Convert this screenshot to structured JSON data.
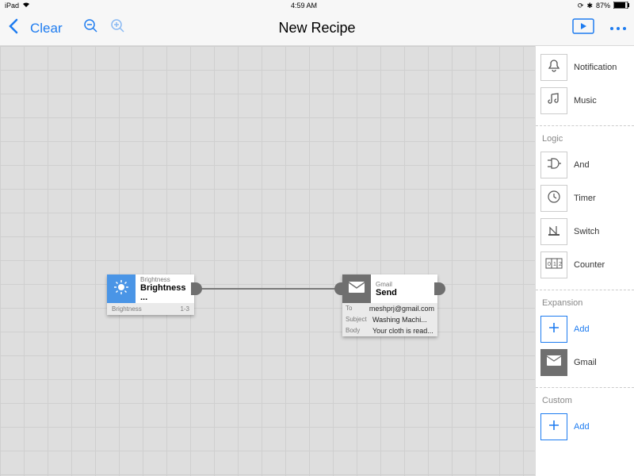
{
  "status": {
    "device": "iPad",
    "time": "4:59 AM",
    "battery": "87%"
  },
  "toolbar": {
    "clear": "Clear",
    "title": "New Recipe"
  },
  "canvas": {
    "brightness": {
      "category": "Brightness",
      "name": "Brightness ...",
      "footerL": "Brightness",
      "footerR": "1-3"
    },
    "gmail": {
      "category": "Gmail",
      "name": "Send",
      "to_lab": "To",
      "to": "meshprj@gmail.com",
      "subj_lab": "Subject",
      "subj": "Washing Machi...",
      "body_lab": "Body",
      "body": "Your cloth is read..."
    }
  },
  "sidebar": {
    "items0": [
      {
        "name": "notification",
        "label": "Notification"
      },
      {
        "name": "music",
        "label": "Music"
      }
    ],
    "logic_title": "Logic",
    "logic": [
      {
        "name": "and",
        "label": "And"
      },
      {
        "name": "timer",
        "label": "Timer"
      },
      {
        "name": "switch",
        "label": "Switch"
      },
      {
        "name": "counter",
        "label": "Counter"
      }
    ],
    "expansion_title": "Expansion",
    "expansion_add": "Add",
    "expansion_gmail": "Gmail",
    "custom_title": "Custom",
    "custom_add": "Add"
  }
}
